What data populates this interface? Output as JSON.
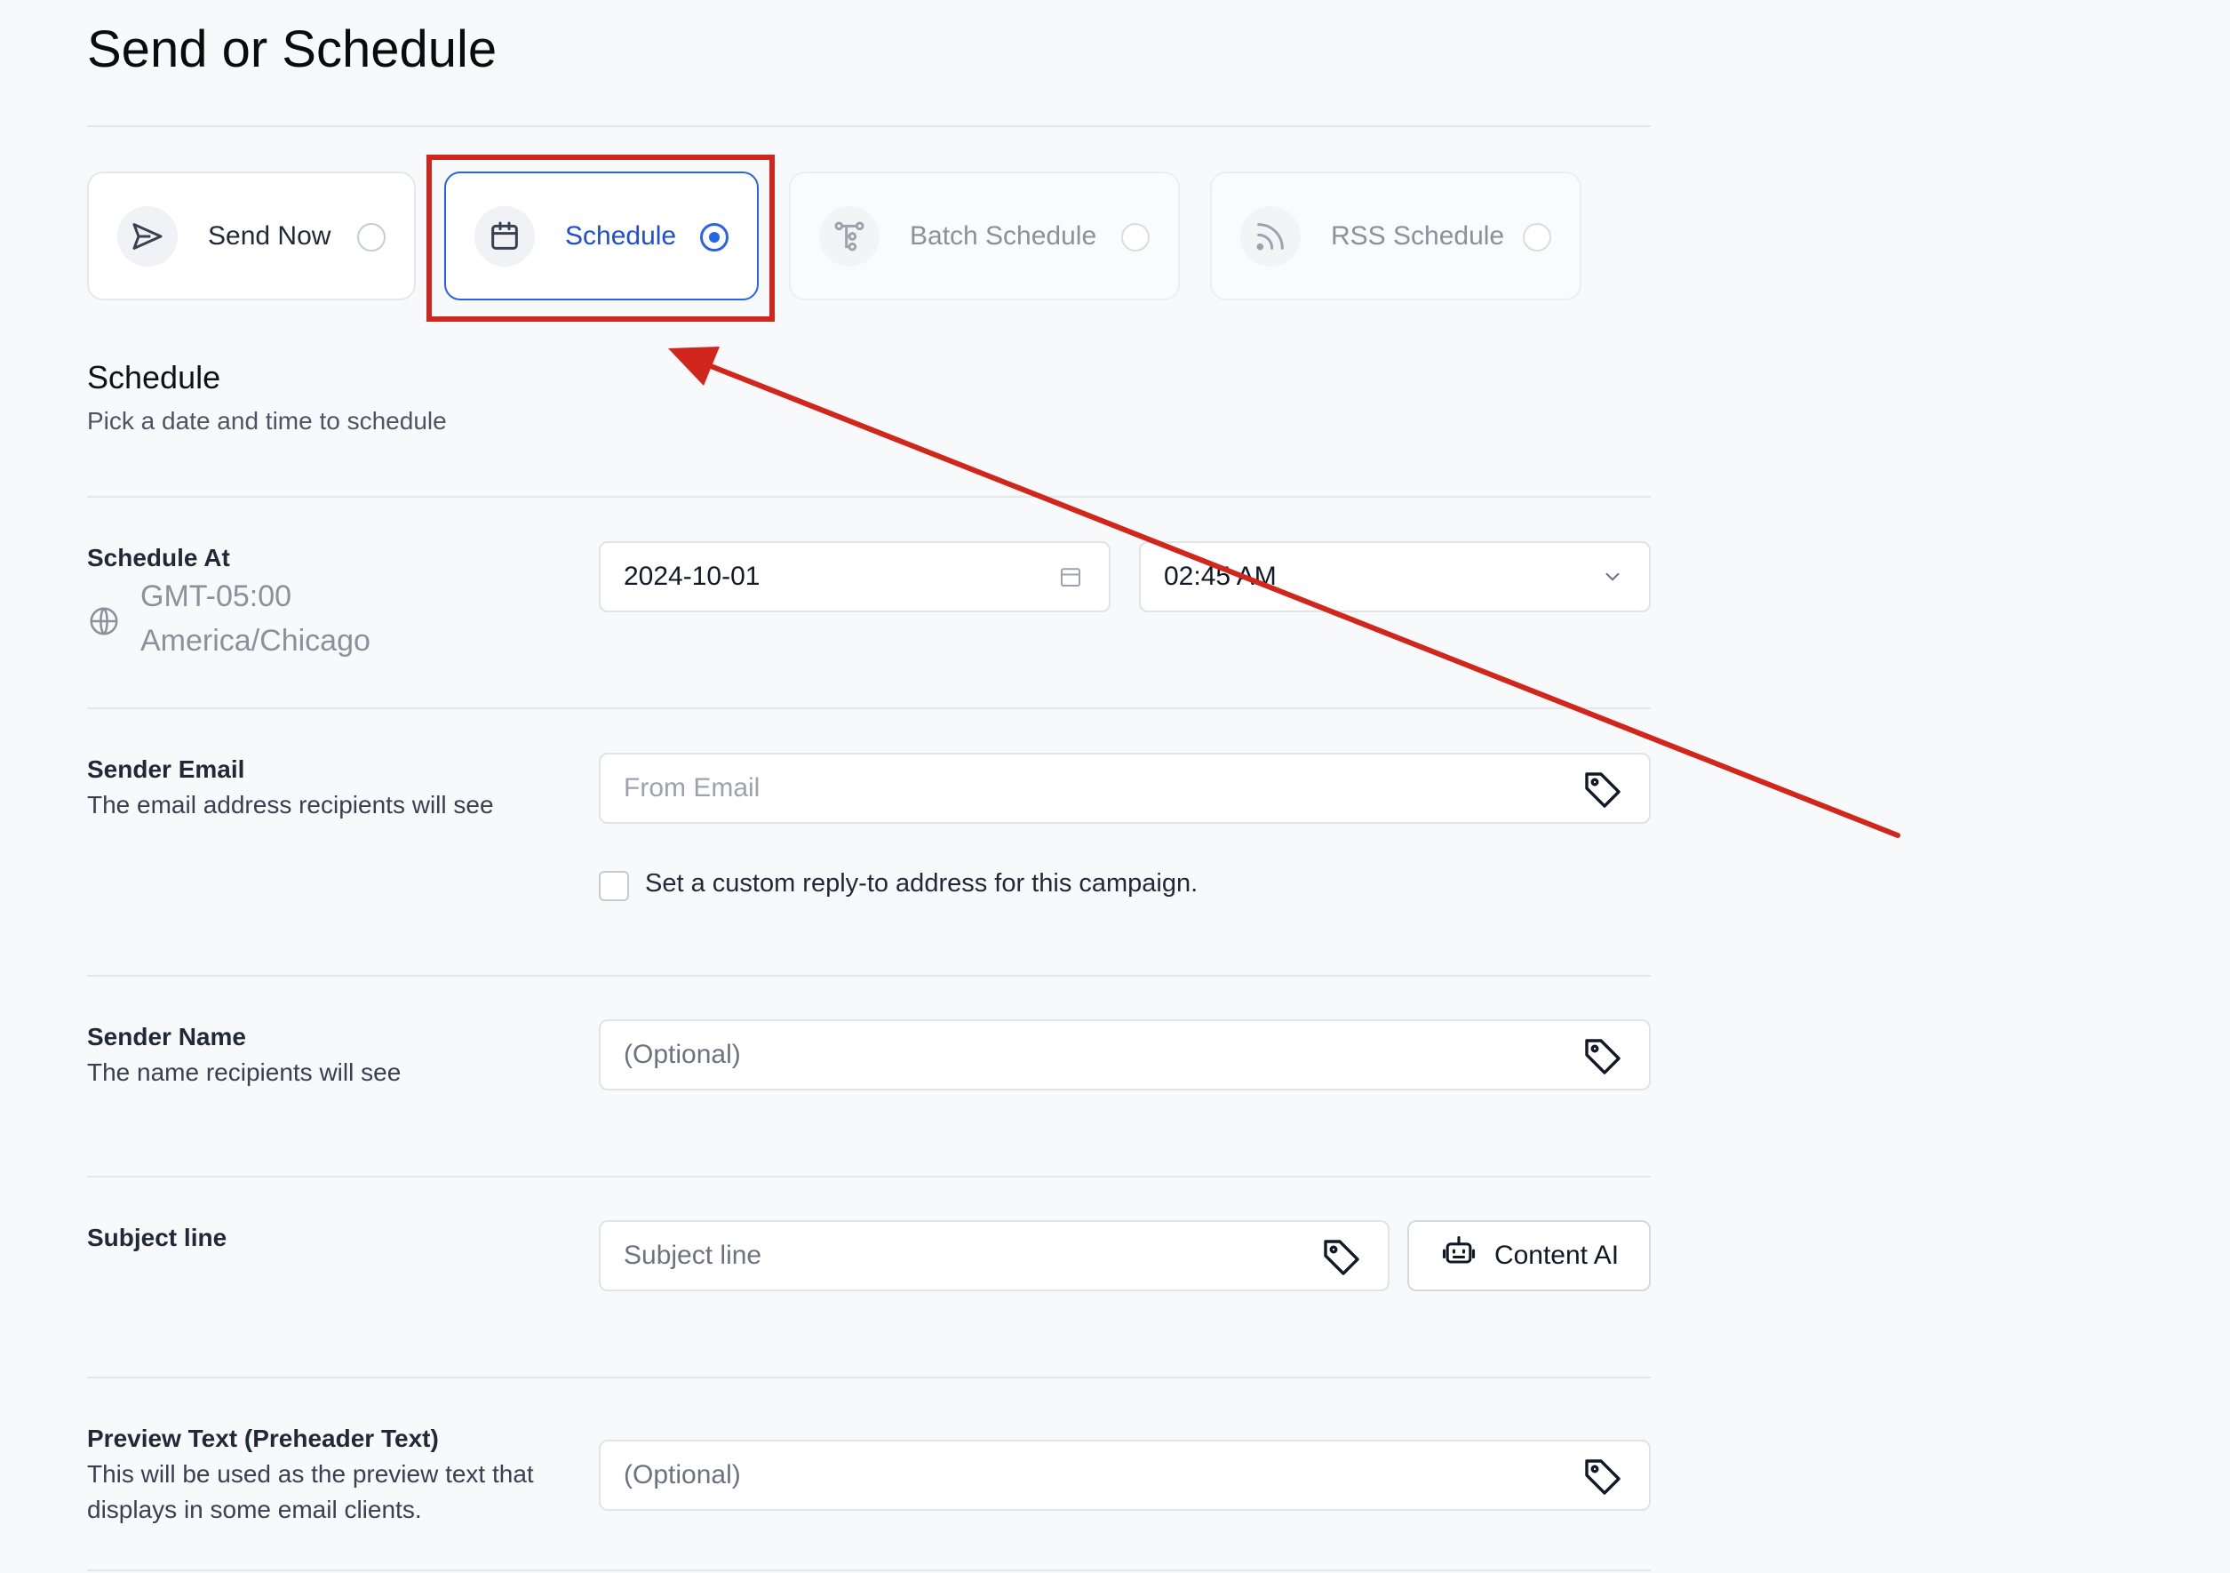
{
  "page": {
    "title": "Send or Schedule"
  },
  "options": [
    {
      "label": "Send Now",
      "icon": "send-icon",
      "state": "default"
    },
    {
      "label": "Schedule",
      "icon": "calendar-icon",
      "state": "selected"
    },
    {
      "label": "Batch Schedule",
      "icon": "batch-icon",
      "state": "disabled"
    },
    {
      "label": "RSS Schedule",
      "icon": "rss-icon",
      "state": "disabled"
    }
  ],
  "section": {
    "title": "Schedule",
    "subtitle": "Pick a date and time to schedule"
  },
  "schedule_at": {
    "label": "Schedule At",
    "tz_offset": "GMT-05:00",
    "tz_name": "America/Chicago",
    "date": "2024-10-01",
    "time": "02:45 AM"
  },
  "sender_email": {
    "label": "Sender Email",
    "description": "The email address recipients will see",
    "placeholder": "From Email",
    "reply_to_label": "Set a custom reply-to address for this campaign."
  },
  "sender_name": {
    "label": "Sender Name",
    "description": "The name recipients will see",
    "placeholder": "(Optional)"
  },
  "subject": {
    "label": "Subject line",
    "placeholder": "Subject line",
    "ai_button": "Content AI"
  },
  "preview_text": {
    "label": "Preview Text (Preheader Text)",
    "description": "This will be used as the preview text that displays in some email clients.",
    "placeholder": "(Optional)"
  },
  "colors": {
    "accent": "#2563eb",
    "annotation": "#d1261c",
    "background": "#f8f9fb"
  }
}
